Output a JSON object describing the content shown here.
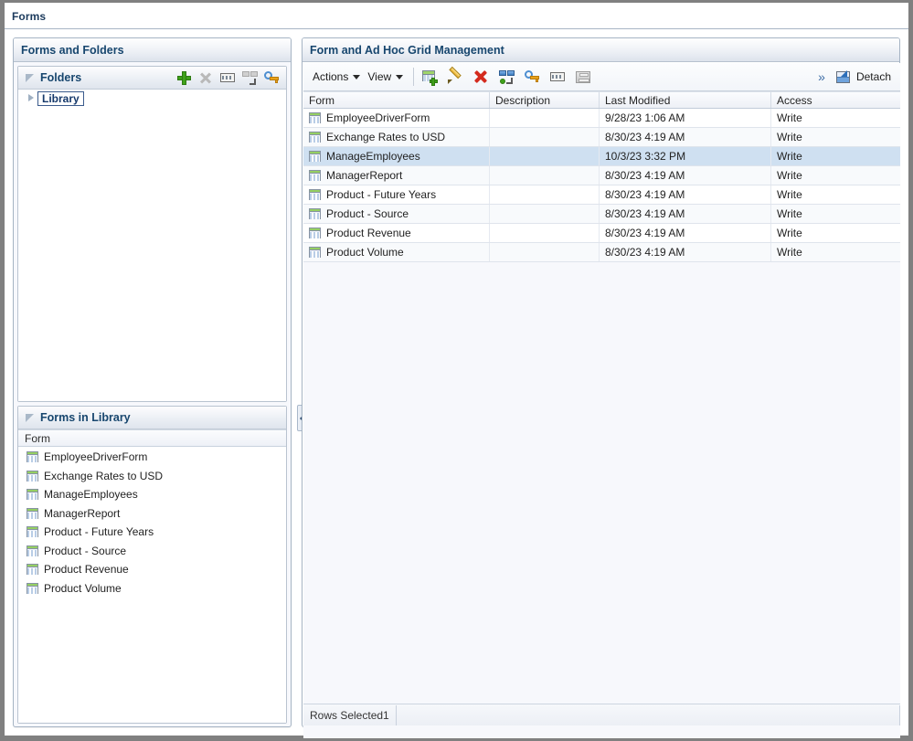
{
  "window": {
    "tab_label": "Forms"
  },
  "left_panel": {
    "title": "Forms and Folders",
    "folders_section": {
      "title": "Folders",
      "toolbar": [
        {
          "name": "add-folder-icon",
          "tooltip": "Create"
        },
        {
          "name": "delete-folder-icon",
          "tooltip": "Delete"
        },
        {
          "name": "rename-folder-icon",
          "tooltip": "Rename"
        },
        {
          "name": "move-folder-icon",
          "tooltip": "Move"
        },
        {
          "name": "assign-permissions-icon",
          "tooltip": "Assign Permission"
        }
      ],
      "tree": [
        {
          "label": "Library",
          "selected": true,
          "expandable": true
        }
      ]
    },
    "forms_section": {
      "title": "Forms in Library",
      "column_header": "Form",
      "items": [
        "EmployeeDriverForm",
        "Exchange Rates to USD",
        "ManageEmployees",
        "ManagerReport",
        "Product - Future Years",
        "Product - Source",
        "Product Revenue",
        "Product Volume"
      ]
    }
  },
  "right_panel": {
    "title": "Form and Ad Hoc Grid Management",
    "toolbar": {
      "actions_label": "Actions",
      "view_label": "View",
      "overflow_label": "»",
      "detach_label": "Detach",
      "buttons": [
        {
          "name": "create-form-icon",
          "tooltip": "Create"
        },
        {
          "name": "edit-form-icon",
          "tooltip": "Edit"
        },
        {
          "name": "delete-form-icon",
          "tooltip": "Delete"
        },
        {
          "name": "move-form-icon",
          "tooltip": "Move"
        },
        {
          "name": "assign-permissions-icon",
          "tooltip": "Assign Permission"
        },
        {
          "name": "rename-form-icon",
          "tooltip": "Rename"
        },
        {
          "name": "save-form-icon",
          "tooltip": "Save"
        }
      ]
    },
    "table": {
      "columns": [
        "Form",
        "Description",
        "Last Modified",
        "Access"
      ],
      "rows": [
        {
          "form": "EmployeeDriverForm",
          "description": "",
          "last_modified": "9/28/23 1:06 AM",
          "access": "Write",
          "selected": false
        },
        {
          "form": "Exchange Rates to USD",
          "description": "",
          "last_modified": "8/30/23 4:19 AM",
          "access": "Write",
          "selected": false
        },
        {
          "form": "ManageEmployees",
          "description": "",
          "last_modified": "10/3/23 3:32 PM",
          "access": "Write",
          "selected": true
        },
        {
          "form": "ManagerReport",
          "description": "",
          "last_modified": "8/30/23 4:19 AM",
          "access": "Write",
          "selected": false
        },
        {
          "form": "Product - Future Years",
          "description": "",
          "last_modified": "8/30/23 4:19 AM",
          "access": "Write",
          "selected": false
        },
        {
          "form": "Product - Source",
          "description": "",
          "last_modified": "8/30/23 4:19 AM",
          "access": "Write",
          "selected": false
        },
        {
          "form": "Product Revenue",
          "description": "",
          "last_modified": "8/30/23 4:19 AM",
          "access": "Write",
          "selected": false
        },
        {
          "form": "Product Volume",
          "description": "",
          "last_modified": "8/30/23 4:19 AM",
          "access": "Write",
          "selected": false
        }
      ]
    },
    "status": {
      "rows_selected": "Rows Selected1"
    }
  },
  "colors": {
    "header_text": "#17466e",
    "selection_row": "#cfe0f1",
    "panel_border": "#a6b4c4",
    "frame": "#808080"
  }
}
